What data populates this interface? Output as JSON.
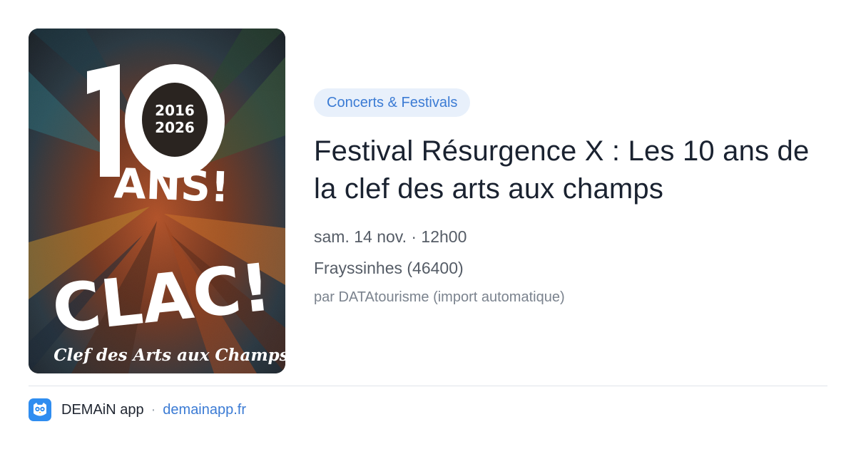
{
  "poster": {
    "years_start": "2016",
    "years_end": "2026",
    "big_number": "10",
    "ans_text": "ANS!",
    "clac_text": "CLAC!",
    "subtitle": "Clef des Arts aux Champs"
  },
  "event": {
    "category": "Concerts & Festivals",
    "title": "Festival Résurgence X : Les 10 ans de la clef des arts aux champs",
    "datetime": "sam. 14 nov. · 12h00",
    "location": "Frayssinhes (46400)",
    "source": "par DATAtourisme (import automatique)"
  },
  "footer": {
    "app_name": "DEMAiN app",
    "separator": "·",
    "domain": "demainapp.fr",
    "logo_icon": "owl-icon"
  },
  "colors": {
    "accent": "#3b7bd4",
    "chip_bg": "#e8f0fb",
    "title": "#1a2230",
    "logo_bg": "#2f8df0"
  }
}
